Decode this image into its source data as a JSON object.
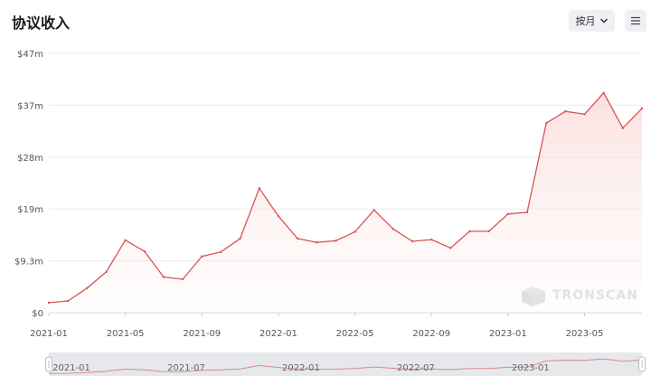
{
  "header": {
    "title": "协议收入",
    "period_label": "按月",
    "period_icon": "chevron-down-icon",
    "menu_icon": "hamburger-menu-icon"
  },
  "watermark": {
    "text": "TRONSCAN",
    "icon": "tronscan-logo-icon"
  },
  "colors": {
    "line": "#d9534f",
    "area": "#fbe3e2",
    "grid": "#ececec",
    "axis_text": "#555555"
  },
  "chart_data": {
    "type": "area",
    "title": "协议收入",
    "xlabel": "",
    "ylabel": "",
    "x": [
      "2021-01",
      "2021-02",
      "2021-03",
      "2021-04",
      "2021-05",
      "2021-06",
      "2021-07",
      "2021-08",
      "2021-09",
      "2021-10",
      "2021-11",
      "2021-12",
      "2022-01",
      "2022-02",
      "2022-03",
      "2022-04",
      "2022-05",
      "2022-06",
      "2022-07",
      "2022-08",
      "2022-09",
      "2022-10",
      "2022-11",
      "2022-12",
      "2023-01",
      "2023-02",
      "2023-03",
      "2023-04",
      "2023-05",
      "2023-06",
      "2023-07",
      "2023-08"
    ],
    "series": [
      {
        "values": [
          1.8,
          2.1,
          4.4,
          7.3,
          13.0,
          11.0,
          6.4,
          6.0,
          10.1,
          10.9,
          13.3,
          22.3,
          17.3,
          13.3,
          12.6,
          12.9,
          14.5,
          18.4,
          15.0,
          12.8,
          13.1,
          11.6,
          14.6,
          14.6,
          17.7,
          18.0,
          34.0,
          36.1,
          35.6,
          39.4,
          33.1,
          36.6
        ]
      }
    ],
    "ylim": [
      0,
      46.5
    ],
    "y_ticks": [
      "$0",
      "$9.3m",
      "$19m",
      "$28m",
      "$37m",
      "$47m"
    ],
    "x_ticks": [
      "2021-01",
      "2021-05",
      "2021-09",
      "2022-01",
      "2022-05",
      "2022-09",
      "2023-01",
      "2023-05"
    ],
    "grid": true,
    "slider": {
      "labels": [
        "2021-01",
        "2021-07",
        "2022-01",
        "2022-07",
        "2023-01"
      ],
      "range_start": "2021-01",
      "range_end": "2023-08"
    }
  }
}
